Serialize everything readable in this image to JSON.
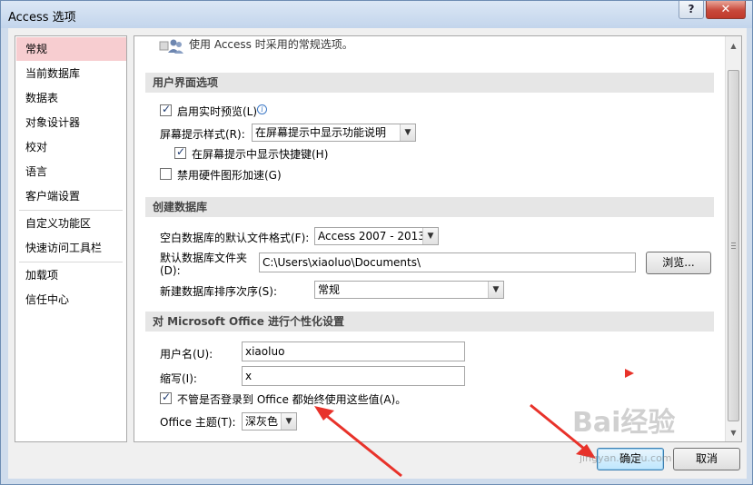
{
  "window": {
    "title": "Access 选项",
    "help_glyph": "?",
    "close_glyph": "✕"
  },
  "nav": {
    "items": [
      "常规",
      "当前数据库",
      "数据表",
      "对象设计器",
      "校对",
      "语言",
      "客户端设置",
      "自定义功能区",
      "快速访问工具栏",
      "加载项",
      "信任中心"
    ],
    "selected": "常规"
  },
  "content": {
    "intro_text": "使用 Access 时采用的常规选项。",
    "ui_section": {
      "header": "用户界面选项",
      "live_preview_label": "启用实时预览(L)",
      "live_preview_checked": true,
      "screentip_label": "屏幕提示样式(R):",
      "screentip_value": "在屏幕提示中显示功能说明",
      "show_shortcut_label": "在屏幕提示中显示快捷键(H)",
      "show_shortcut_checked": true,
      "disable_hw_label": "禁用硬件图形加速(G)",
      "disable_hw_checked": false
    },
    "db_section": {
      "header": "创建数据库",
      "format_label": "空白数据库的默认文件格式(F):",
      "format_value": "Access 2007 - 2013",
      "folder_label_line1": "默认数据库文件夹",
      "folder_label_line2": "(D):",
      "folder_value": "C:\\Users\\xiaoluo\\Documents\\",
      "browse_label": "浏览...",
      "sort_label": "新建数据库排序次序(S):",
      "sort_value": "常规"
    },
    "personal_section": {
      "header": "对 Microsoft Office 进行个性化设置",
      "username_label": "用户名(U):",
      "username_value": "xiaoluo",
      "initials_label": "缩写(I):",
      "initials_value": "x",
      "always_use_label": "不管是否登录到 Office 都始终使用这些值(A)。",
      "always_use_checked": true,
      "theme_label": "Office 主题(T):",
      "theme_value": "深灰色"
    }
  },
  "footer": {
    "ok_label": "确定",
    "cancel_label": "取消"
  },
  "icons": {
    "info": "info-icon",
    "dropdown": "chevron-down-icon",
    "users": "users-icon"
  },
  "watermark": {
    "brand": "Bai经验",
    "url": "jingyan.baidu.com"
  },
  "colors": {
    "selected_nav": "#f7cdd0",
    "annotation_red": "#e8322a",
    "ok_button_border": "#3c7fb1"
  }
}
